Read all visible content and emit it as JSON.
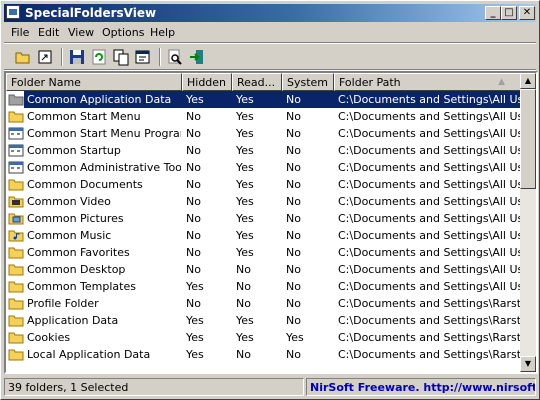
{
  "window": {
    "title": "SpecialFoldersView"
  },
  "menu": [
    "File",
    "Edit",
    "View",
    "Options",
    "Help"
  ],
  "toolbar": {
    "buttons": [
      "open-folder",
      "shortcut",
      "save",
      "refresh",
      "copy",
      "properties",
      "find",
      "exit"
    ]
  },
  "columns": [
    "Folder Name",
    "Hidden",
    "Read...",
    "System",
    "Folder Path"
  ],
  "rows": [
    {
      "name": "Common Application Data",
      "hidden": "Yes",
      "read": "Yes",
      "system": "No",
      "path": "C:\\Documents and Settings\\All Users\\",
      "icon": "folder-gray",
      "selected": true
    },
    {
      "name": "Common Start Menu",
      "hidden": "No",
      "read": "Yes",
      "system": "No",
      "path": "C:\\Documents and Settings\\All Users\\",
      "icon": "folder"
    },
    {
      "name": "Common Start Menu Programs",
      "hidden": "No",
      "read": "Yes",
      "system": "No",
      "path": "C:\\Documents and Settings\\All Users\\",
      "icon": "programs"
    },
    {
      "name": "Common Startup",
      "hidden": "No",
      "read": "Yes",
      "system": "No",
      "path": "C:\\Documents and Settings\\All Users\\",
      "icon": "programs"
    },
    {
      "name": "Common Administrative Tools",
      "hidden": "No",
      "read": "Yes",
      "system": "No",
      "path": "C:\\Documents and Settings\\All Users\\",
      "icon": "programs"
    },
    {
      "name": "Common Documents",
      "hidden": "No",
      "read": "Yes",
      "system": "No",
      "path": "C:\\Documents and Settings\\All Users\\",
      "icon": "folder"
    },
    {
      "name": "Common Video",
      "hidden": "No",
      "read": "Yes",
      "system": "No",
      "path": "C:\\Documents and Settings\\All Users\\",
      "icon": "video"
    },
    {
      "name": "Common Pictures",
      "hidden": "No",
      "read": "Yes",
      "system": "No",
      "path": "C:\\Documents and Settings\\All Users\\",
      "icon": "pictures"
    },
    {
      "name": "Common Music",
      "hidden": "No",
      "read": "Yes",
      "system": "No",
      "path": "C:\\Documents and Settings\\All Users\\",
      "icon": "music"
    },
    {
      "name": "Common Favorites",
      "hidden": "No",
      "read": "Yes",
      "system": "No",
      "path": "C:\\Documents and Settings\\All Users\\",
      "icon": "folder"
    },
    {
      "name": "Common Desktop",
      "hidden": "No",
      "read": "No",
      "system": "No",
      "path": "C:\\Documents and Settings\\All Users\\",
      "icon": "folder"
    },
    {
      "name": "Common Templates",
      "hidden": "Yes",
      "read": "No",
      "system": "No",
      "path": "C:\\Documents and Settings\\All Users\\",
      "icon": "folder"
    },
    {
      "name": "Profile Folder",
      "hidden": "No",
      "read": "No",
      "system": "No",
      "path": "C:\\Documents and Settings\\Rarst",
      "icon": "folder"
    },
    {
      "name": "Application Data",
      "hidden": "Yes",
      "read": "Yes",
      "system": "No",
      "path": "C:\\Documents and Settings\\Rarst\\App",
      "icon": "folder"
    },
    {
      "name": "Cookies",
      "hidden": "Yes",
      "read": "Yes",
      "system": "Yes",
      "path": "C:\\Documents and Settings\\Rarst\\Coo",
      "icon": "folder"
    },
    {
      "name": "Local Application Data",
      "hidden": "Yes",
      "read": "No",
      "system": "No",
      "path": "C:\\Documents and Settings\\Rarst\\Loca",
      "icon": "folder"
    }
  ],
  "status": {
    "count": "39 folders, 1 Selected",
    "credit": "NirSoft Freeware.  http://www.nirsoft.n"
  },
  "colors": {
    "selection": "#0a246a",
    "folder": "#f4d25a"
  }
}
